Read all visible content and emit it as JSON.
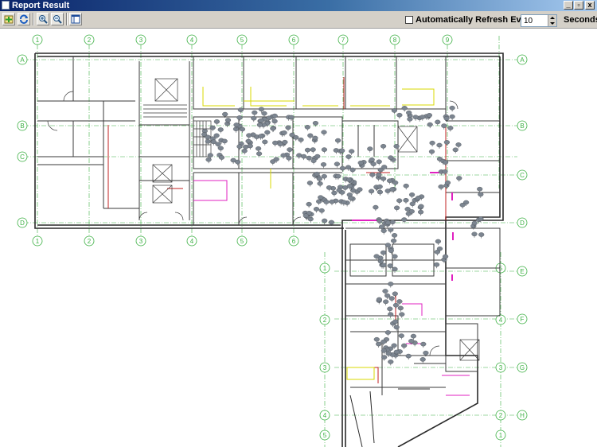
{
  "window": {
    "title": "Report Result",
    "buttons": {
      "minimize": "_",
      "maximize": "▫",
      "close": "x"
    }
  },
  "toolbar": {
    "refresh_checkbox_label": "Automatically Refresh Every",
    "refresh_interval_value": "10",
    "refresh_unit_label": "Seconds",
    "refresh_checked": false
  },
  "floorplan": {
    "top_grid_labels": [
      "1",
      "2",
      "3",
      "4",
      "5",
      "6",
      "7",
      "8",
      "9"
    ],
    "bottom_grid_labels": [
      "1",
      "2",
      "3",
      "4",
      "5",
      "6"
    ],
    "left_grid_labels": [
      "A",
      "B",
      "C",
      "D"
    ],
    "right_grid_labels": [
      "A",
      "B",
      "C",
      "D",
      "E",
      "F",
      "G",
      "H"
    ],
    "lower_left_grid_labels": [
      "1",
      "2",
      "3",
      "4",
      "5"
    ],
    "lower_right_grid_labels": [
      "5",
      "4",
      "3",
      "2",
      "1"
    ],
    "colors": {
      "wall": "#2a2a2a",
      "grid": "#3cb043",
      "accent_magenta": "#e020c0",
      "accent_yellow": "#d8d800",
      "accent_red": "#c02020",
      "person_marker": "#7c8590"
    }
  }
}
